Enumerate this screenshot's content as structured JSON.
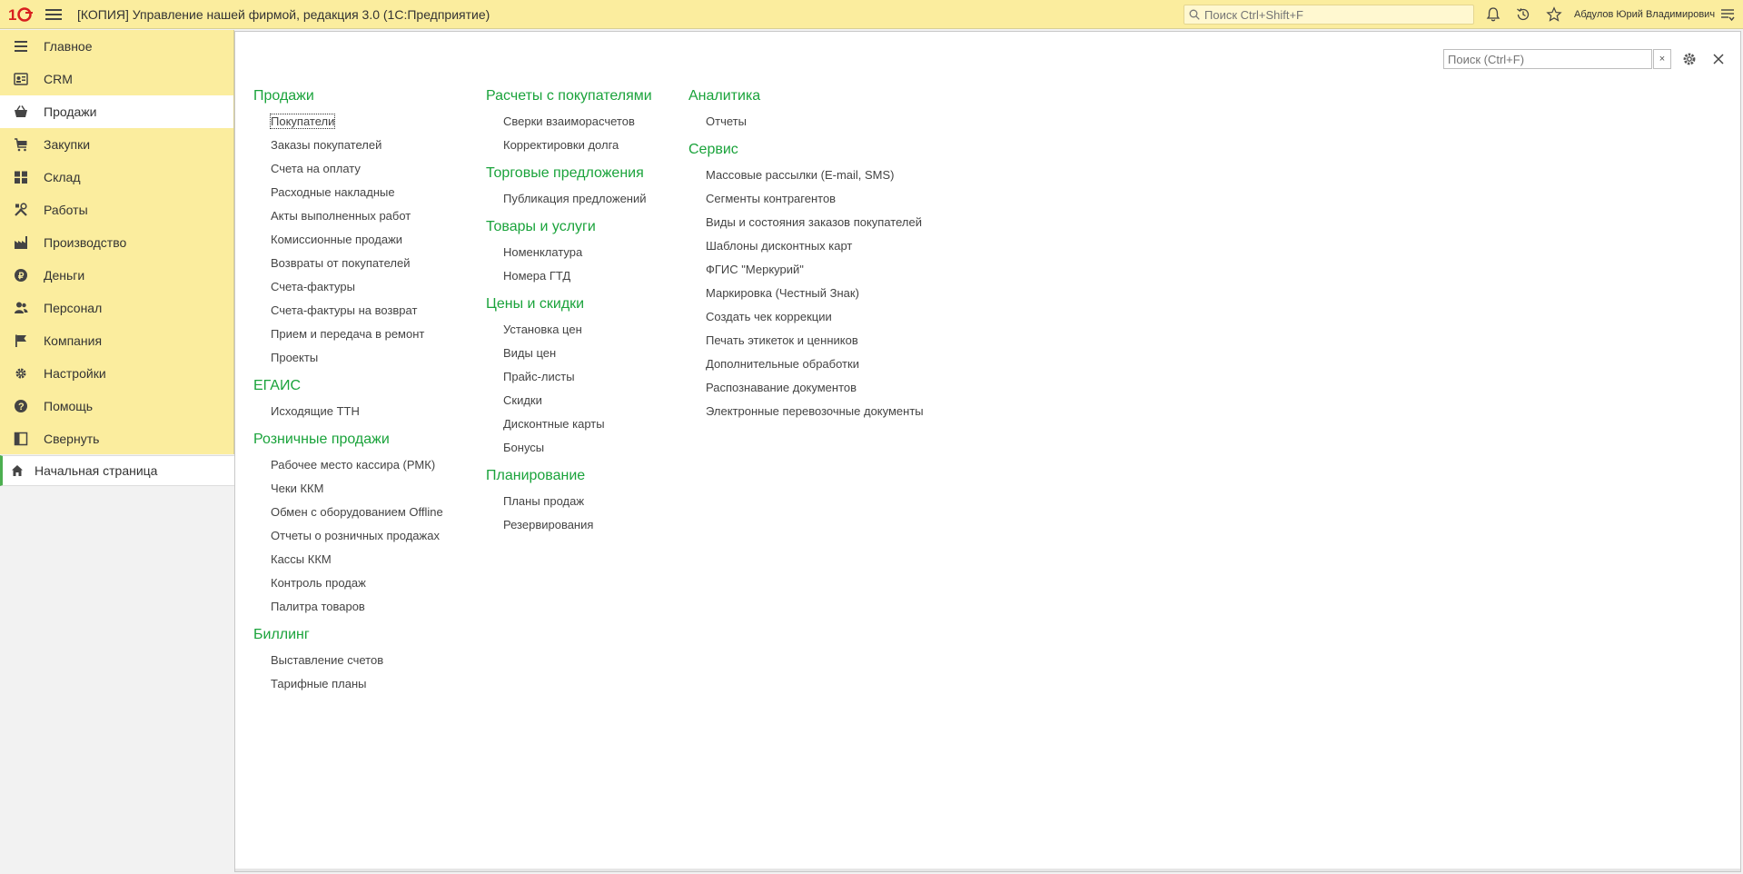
{
  "app": {
    "title": "[КОПИЯ] Управление нашей фирмой, редакция 3.0  (1С:Предприятие)",
    "search_placeholder": "Поиск Ctrl+Shift+F",
    "user": "Абдулов Юрий Владимирович"
  },
  "sidebar": {
    "items": [
      {
        "label": "Главное",
        "icon": "list-icon"
      },
      {
        "label": "CRM",
        "icon": "crm-icon"
      },
      {
        "label": "Продажи",
        "icon": "basket-icon",
        "active": true
      },
      {
        "label": "Закупки",
        "icon": "cart-icon"
      },
      {
        "label": "Склад",
        "icon": "warehouse-icon"
      },
      {
        "label": "Работы",
        "icon": "tools-icon"
      },
      {
        "label": "Производство",
        "icon": "factory-icon"
      },
      {
        "label": "Деньги",
        "icon": "money-icon"
      },
      {
        "label": "Персонал",
        "icon": "people-icon"
      },
      {
        "label": "Компания",
        "icon": "flag-icon"
      },
      {
        "label": "Настройки",
        "icon": "gear-icon"
      },
      {
        "label": "Помощь",
        "icon": "help-icon"
      },
      {
        "label": "Свернуть",
        "icon": "collapse-icon"
      }
    ],
    "home": "Начальная страница"
  },
  "panel": {
    "search_placeholder": "Поиск (Ctrl+F)",
    "clear_label": "×",
    "columns": [
      [
        {
          "title": "Продажи",
          "links": [
            "Покупатели",
            "Заказы покупателей",
            "Счета на оплату",
            "Расходные накладные",
            "Акты выполненных работ",
            "Комиссионные продажи",
            "Возвраты от покупателей",
            "Счета-фактуры",
            "Счета-фактуры на возврат",
            "Прием и передача в ремонт",
            "Проекты"
          ]
        },
        {
          "title": "ЕГАИС",
          "links": [
            "Исходящие ТТН"
          ]
        },
        {
          "title": "Розничные продажи",
          "links": [
            "Рабочее место кассира (РМК)",
            "Чеки ККМ",
            "Обмен с оборудованием Offline",
            "Отчеты о розничных продажах",
            "Кассы ККМ",
            "Контроль продаж",
            "Палитра товаров"
          ]
        },
        {
          "title": "Биллинг",
          "links": [
            "Выставление счетов",
            "Тарифные планы"
          ]
        }
      ],
      [
        {
          "title": "Расчеты с покупателями",
          "links": [
            "Сверки взаиморасчетов",
            "Корректировки долга"
          ]
        },
        {
          "title": "Торговые предложения",
          "links": [
            "Публикация предложений"
          ]
        },
        {
          "title": "Товары и услуги",
          "links": [
            "Номенклатура",
            "Номера ГТД"
          ]
        },
        {
          "title": "Цены и скидки",
          "links": [
            "Установка цен",
            "Виды цен",
            "Прайс-листы",
            "Скидки",
            "Дисконтные карты",
            "Бонусы"
          ]
        },
        {
          "title": "Планирование",
          "links": [
            "Планы продаж",
            "Резервирования"
          ]
        }
      ],
      [
        {
          "title": "Аналитика",
          "links": [
            "Отчеты"
          ]
        },
        {
          "title": "Сервис",
          "links": [
            "Массовые рассылки (E-mail, SMS)",
            "Сегменты контрагентов",
            "Виды и состояния заказов покупателей",
            "Шаблоны дисконтных карт",
            "ФГИС \"Меркурий\"",
            "Маркировка (Честный Знак)",
            "Создать чек коррекции",
            "Печать этикеток и ценников",
            "Дополнительные обработки",
            "Распознавание документов",
            "Электронные перевозочные документы"
          ]
        }
      ]
    ]
  },
  "colors": {
    "accent_green": "#1aa33b",
    "bar_yellow": "#fbed9e",
    "logo_red": "#d81f1f"
  }
}
